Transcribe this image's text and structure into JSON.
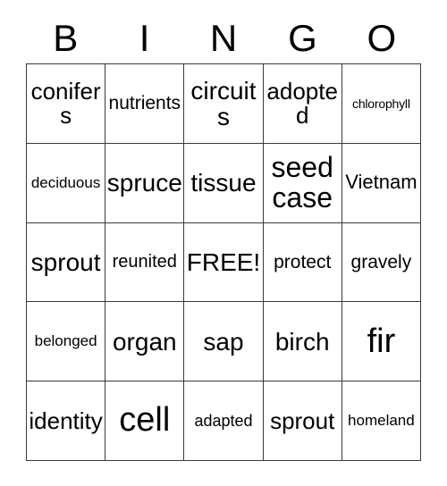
{
  "card": {
    "title": "BINGO",
    "header_letters": [
      "B",
      "I",
      "N",
      "G",
      "O"
    ],
    "free_space_label": "FREE!",
    "colors": {
      "background": "#ffffff",
      "grid_line": "#3a3a3a",
      "text": "#000000"
    },
    "grid_size": "5x5",
    "rows": [
      [
        {
          "text": "conifers",
          "size": "xl"
        },
        {
          "text": "nutrients",
          "size": "ml"
        },
        {
          "text": "circuits",
          "size": "xxl"
        },
        {
          "text": "adopted",
          "size": "xl"
        },
        {
          "text": "chlorophyll",
          "size": "xxs"
        }
      ],
      [
        {
          "text": "deciduous",
          "size": "xs"
        },
        {
          "text": "spruce",
          "size": "xxl"
        },
        {
          "text": "tissue",
          "size": "xxl"
        },
        {
          "text": "seed case",
          "size": "3xl"
        },
        {
          "text": "Vietnam",
          "size": "l"
        }
      ],
      [
        {
          "text": "sprout",
          "size": "xxl"
        },
        {
          "text": "reunited",
          "size": "m"
        },
        {
          "text": "FREE!",
          "size": "xxl"
        },
        {
          "text": "protect",
          "size": "ml"
        },
        {
          "text": "gravely",
          "size": "ml"
        }
      ],
      [
        {
          "text": "belonged",
          "size": "xs"
        },
        {
          "text": "organ",
          "size": "xxl"
        },
        {
          "text": "sap",
          "size": "xxl"
        },
        {
          "text": "birch",
          "size": "xxl"
        },
        {
          "text": "fir",
          "size": "4xl"
        }
      ],
      [
        {
          "text": "identity",
          "size": "xl"
        },
        {
          "text": "cell",
          "size": "4xl"
        },
        {
          "text": "adapted",
          "size": "s"
        },
        {
          "text": "sprout",
          "size": "xl"
        },
        {
          "text": "homeland",
          "size": "xs"
        }
      ]
    ]
  }
}
